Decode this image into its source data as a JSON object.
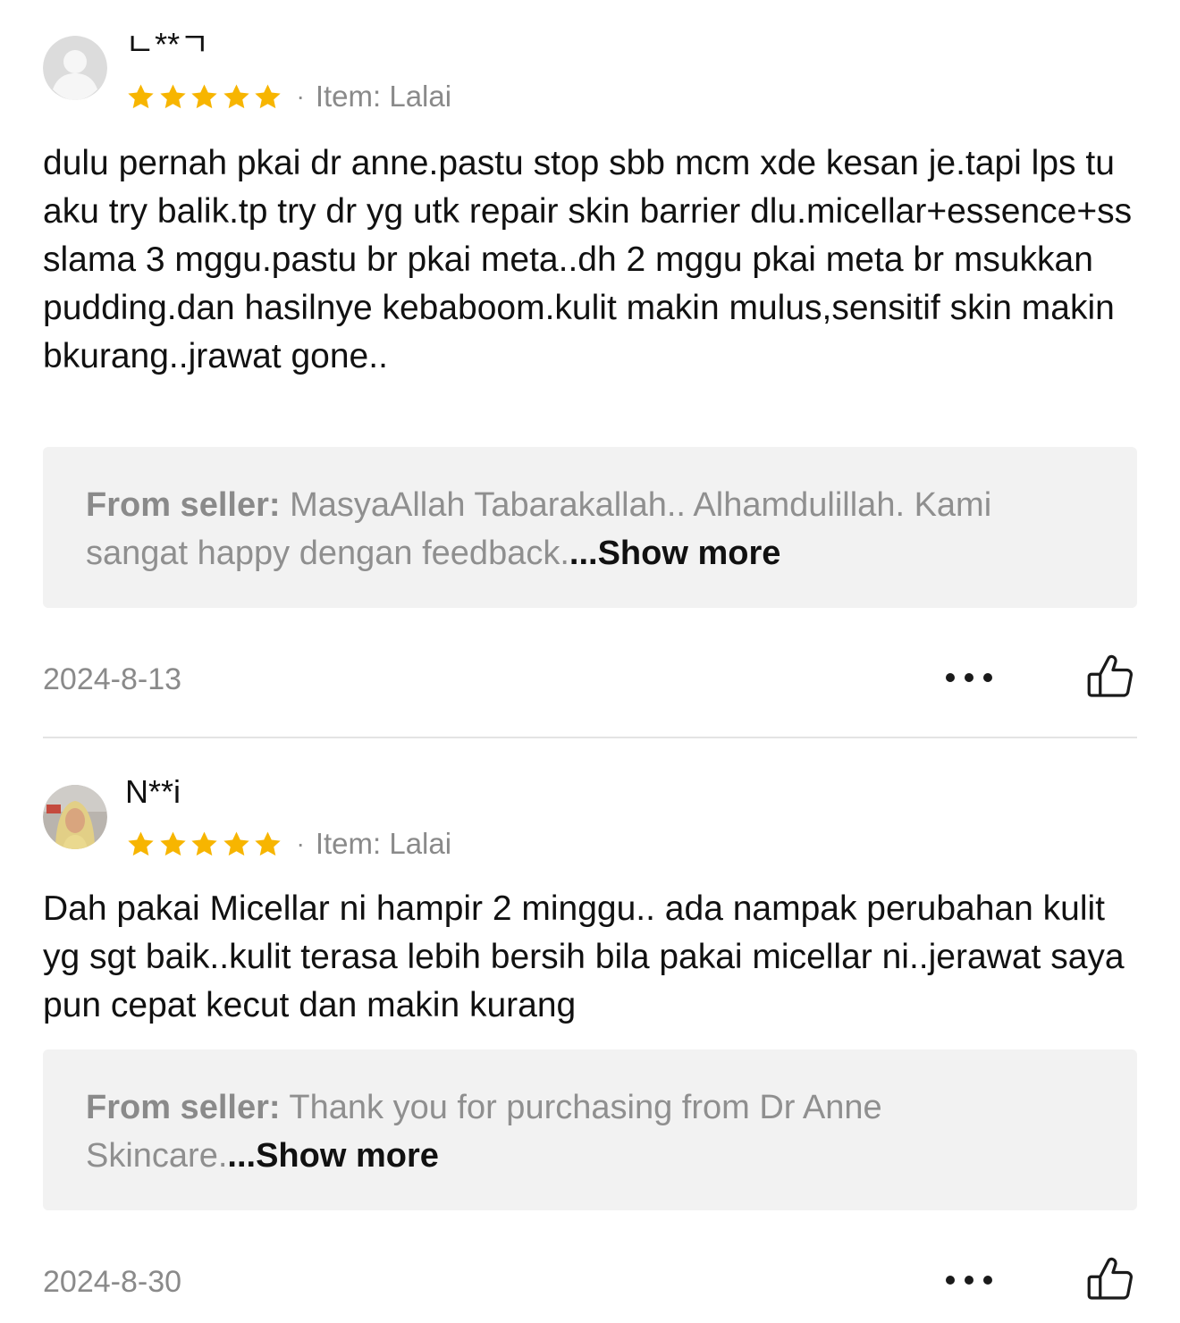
{
  "reviews": [
    {
      "username": "ㄴ**ㄱ",
      "rating": 5,
      "rating_max": 5,
      "avatar": "default-user-avatar",
      "item_label": "Item: Lalai",
      "text": "dulu pernah pkai dr anne.pastu stop sbb mcm xde kesan je.tapi lps tu aku try balik.tp try dr yg utk repair skin barrier dlu.micellar+essence+ss slama 3 mggu.pastu br pkai meta..dh 2 mggu pkai meta br msukkan pudding.dan hasilnye kebaboom.kulit makin mulus,sensitif skin makin bkurang..jrawat gone..",
      "seller_prefix": "From seller:",
      "seller_reply": "MasyaAllah Tabarakallah.. Alhamdulillah. Kami sangat happy dengan feedback.",
      "show_more": "...Show more",
      "date": "2024-8-13"
    },
    {
      "username": "N**i",
      "rating": 5,
      "rating_max": 5,
      "avatar": "user-photo-avatar",
      "item_label": "Item: Lalai",
      "text": "Dah pakai Micellar ni hampir 2 minggu.. ada nampak perubahan kulit yg sgt baik..kulit terasa lebih bersih bila pakai micellar ni..jerawat saya pun cepat kecut dan makin kurang",
      "seller_prefix": "From seller:",
      "seller_reply": "Thank you for purchasing from Dr Anne Skincare.",
      "show_more": "...Show more",
      "date": "2024-8-30"
    }
  ],
  "colors": {
    "star": "#F7B500",
    "muted_text": "#8a8a8a",
    "seller_box_bg": "#f2f2f2",
    "divider": "#e4e4e4"
  },
  "icons": {
    "rating": "star-icon",
    "more": "more-horizontal-icon",
    "like": "thumbs-up-icon"
  }
}
